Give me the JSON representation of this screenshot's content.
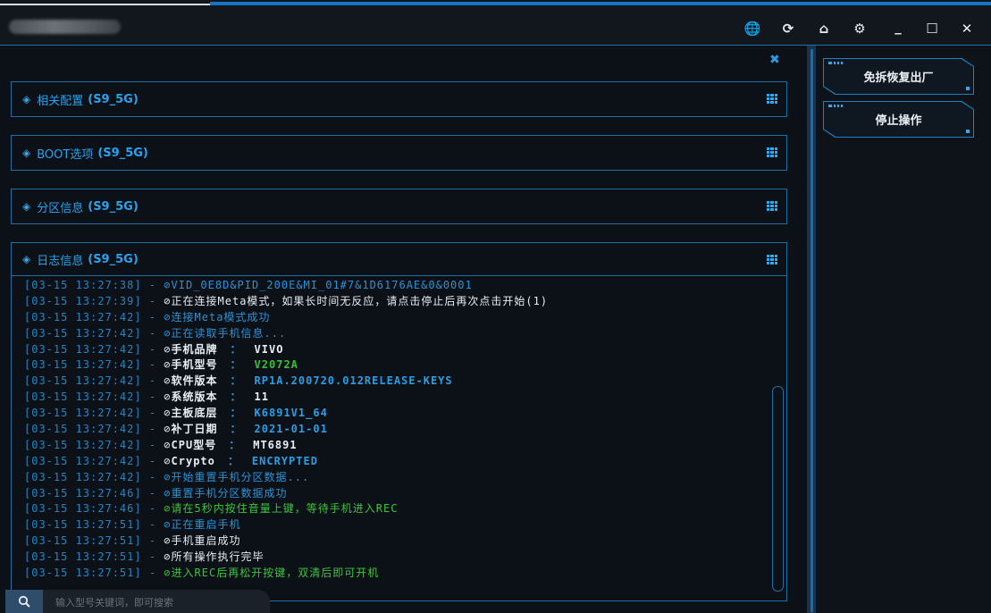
{
  "window": {
    "controls": {
      "globe": "🌐",
      "refresh": "⟳",
      "home": "⌂",
      "settings": "⚙",
      "minimize": "_",
      "maximize": "☐",
      "close": "✕"
    },
    "panel_close": "✖"
  },
  "panels": [
    {
      "title": "相关配置",
      "model": "(S9_5G)"
    },
    {
      "title": "BOOT选项",
      "model": "(S9_5G)"
    },
    {
      "title": "分区信息",
      "model": "(S9_5G)"
    },
    {
      "title": "日志信息",
      "model": "(S9_5G)"
    }
  ],
  "log": [
    {
      "ts": "[03-15 13:27:38]",
      "color": "blue",
      "msg": "VID_0E8D&PID_200E&MI_01#7&1D6176AE&0&0001"
    },
    {
      "ts": "[03-15 13:27:39]",
      "color": "white",
      "msg": "正在连接Meta模式，如果长时间无反应，请点击停止后再次点击开始(1)"
    },
    {
      "ts": "[03-15 13:27:42]",
      "color": "blue",
      "msg": "连接Meta模式成功"
    },
    {
      "ts": "[03-15 13:27:42]",
      "color": "blue",
      "msg": "正在读取手机信息..."
    },
    {
      "ts": "[03-15 13:27:42]",
      "color": "kv",
      "label": "手机品牌",
      "sep": "：",
      "value": "VIVO",
      "vcolor": "white"
    },
    {
      "ts": "[03-15 13:27:42]",
      "color": "kv",
      "label": "手机型号",
      "sep": "：",
      "value": "V2072A",
      "vcolor": "green"
    },
    {
      "ts": "[03-15 13:27:42]",
      "color": "kv",
      "label": "软件版本",
      "sep": "：",
      "value": "RP1A.200720.012RELEASE-KEYS",
      "vcolor": "blue"
    },
    {
      "ts": "[03-15 13:27:42]",
      "color": "kv",
      "label": "系统版本",
      "sep": "：",
      "value": "11",
      "vcolor": "white"
    },
    {
      "ts": "[03-15 13:27:42]",
      "color": "kv",
      "label": "主板底层",
      "sep": "：",
      "value": "K6891V1_64",
      "vcolor": "blue"
    },
    {
      "ts": "[03-15 13:27:42]",
      "color": "kv",
      "label": "补丁日期",
      "sep": "：",
      "value": "2021-01-01",
      "vcolor": "blue"
    },
    {
      "ts": "[03-15 13:27:42]",
      "color": "kv",
      "label": "CPU型号",
      "sep": "：",
      "value": "MT6891",
      "vcolor": "white"
    },
    {
      "ts": "[03-15 13:27:42]",
      "color": "kv",
      "label": "Crypto",
      "sep": "：",
      "value": "ENCRYPTED",
      "vcolor": "blue"
    },
    {
      "ts": "[03-15 13:27:42]",
      "color": "blue",
      "msg": "开始重置手机分区数据..."
    },
    {
      "ts": "[03-15 13:27:46]",
      "color": "blue",
      "msg": "重置手机分区数据成功"
    },
    {
      "ts": "[03-15 13:27:46]",
      "color": "green",
      "msg": "请在5秒内按住音量上键，等待手机进入REC"
    },
    {
      "ts": "[03-15 13:27:51]",
      "color": "blue",
      "msg": "正在重启手机"
    },
    {
      "ts": "[03-15 13:27:51]",
      "color": "white",
      "msg": "手机重启成功"
    },
    {
      "ts": "[03-15 13:27:51]",
      "color": "white",
      "msg": "所有操作执行完毕"
    },
    {
      "ts": "[03-15 13:27:51]",
      "color": "green",
      "msg": "进入REC后再松开按键，双清后即可开机"
    }
  ],
  "log_separator": " - ",
  "check_glyph": "⊘",
  "search": {
    "placeholder": "输入型号关键词，即可搜索"
  },
  "actions": {
    "factory_reset": "免拆恢复出厂",
    "stop": "停止操作"
  }
}
